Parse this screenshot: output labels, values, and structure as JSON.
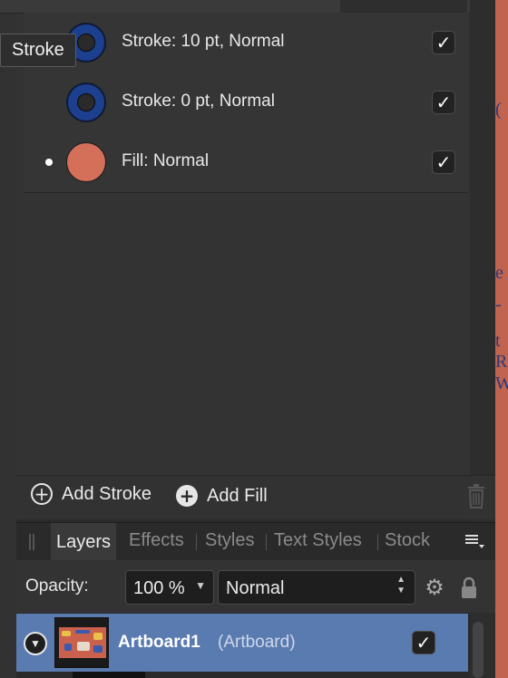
{
  "tooltip": {
    "text": "Stroke"
  },
  "effects": [
    {
      "label": "Stroke: 10 pt, Normal",
      "swatch": "stroke",
      "selected": false,
      "checked": true
    },
    {
      "label": "Stroke: 0 pt, Normal",
      "swatch": "stroke",
      "selected": false,
      "checked": true
    },
    {
      "label": "Fill: Normal",
      "swatch": "fill",
      "selected": true,
      "checked": true
    }
  ],
  "actions": {
    "add_stroke": "Add Stroke",
    "add_fill": "Add Fill"
  },
  "tabs": [
    "Layers",
    "Effects",
    "Styles",
    "Text Styles",
    "Stock"
  ],
  "active_tab": "Layers",
  "layer_options": {
    "opacity_label": "Opacity:",
    "opacity_value": "100 %",
    "blend_mode": "Normal"
  },
  "layer": {
    "name": "Artboard1",
    "type": "(Artboard)",
    "visible": true
  },
  "colors": {
    "stroke": "#1c3f8e",
    "fill": "#d4705a",
    "selection": "#5a7bb0"
  }
}
